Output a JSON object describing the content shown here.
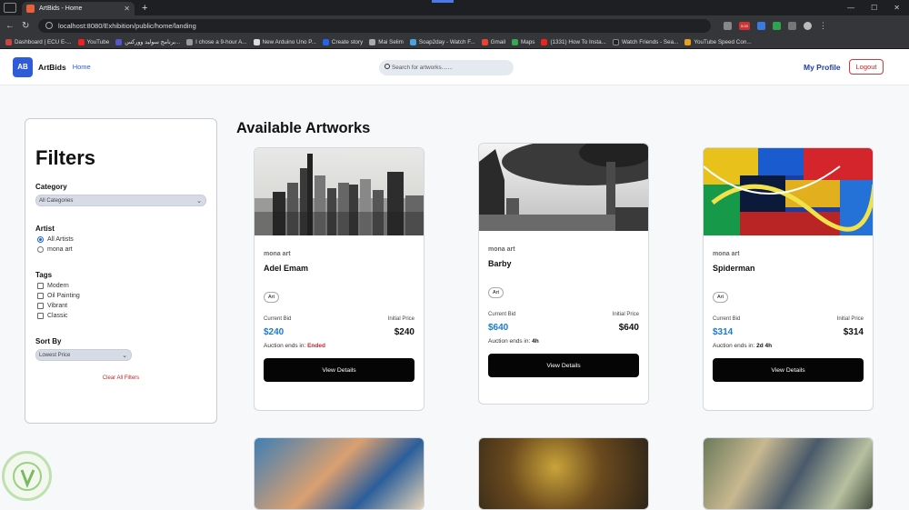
{
  "browser": {
    "tab_title": "ArtBids - Home",
    "url": "localhost:8080/Exhibition/public/home/landing",
    "bookmarks": [
      "Dashboard | ECU E-...",
      "YouTube",
      "برنامج سوليد ووركس...",
      "I chose a 9-hour A...",
      "New Arduino Uno P...",
      "Create story",
      "Mai Selim",
      "Soap2day - Watch F...",
      "Gmail",
      "Maps",
      "(1331) How To Insta...",
      "Watch Friends - Sea...",
      "YouTube Speed Con..."
    ],
    "badge_ext": "5.00"
  },
  "nav": {
    "logo": "AB",
    "brand": "ArtBids",
    "home": "Home",
    "search_placeholder": "Search for artworks.......",
    "profile": "My Profile",
    "logout": "Logout"
  },
  "filters": {
    "title": "Filters",
    "category_label": "Category",
    "category_value": "All Categories",
    "artist_label": "Artist",
    "artist_options": [
      "All Artists",
      "mona art"
    ],
    "tags_label": "Tags",
    "tags": [
      "Modern",
      "Oil Painting",
      "Vibrant",
      "Classic"
    ],
    "sort_label": "Sort By",
    "sort_value": "Lowest Price",
    "clear": "Clear All Filters"
  },
  "main": {
    "heading": "Available Artworks",
    "cards": [
      {
        "artist": "mona art",
        "title": "Adel Emam",
        "tag": "Art",
        "current_bid_label": "Current Bid",
        "initial_price_label": "Initial Price",
        "current_bid": "$240",
        "initial_price": "$240",
        "ends_label": "Auction ends in:",
        "ends_value": "Ended",
        "button": "View Details"
      },
      {
        "artist": "mona art",
        "title": "Barby",
        "tag": "Art",
        "current_bid_label": "Current Bid",
        "initial_price_label": "Initial Price",
        "current_bid": "$640",
        "initial_price": "$640",
        "ends_label": "Auction ends in:",
        "ends_value": "4h",
        "button": "View Details"
      },
      {
        "artist": "mona art",
        "title": "Spiderman",
        "tag": "Art",
        "current_bid_label": "Current Bid",
        "initial_price_label": "Initial Price",
        "current_bid": "$314",
        "initial_price": "$314",
        "ends_label": "Auction ends in:",
        "ends_value": "2d 4h",
        "button": "View Details"
      }
    ]
  },
  "colors": {
    "accent": "#2e5bd8",
    "bid": "#1a7bd0",
    "danger": "#cc2222"
  }
}
